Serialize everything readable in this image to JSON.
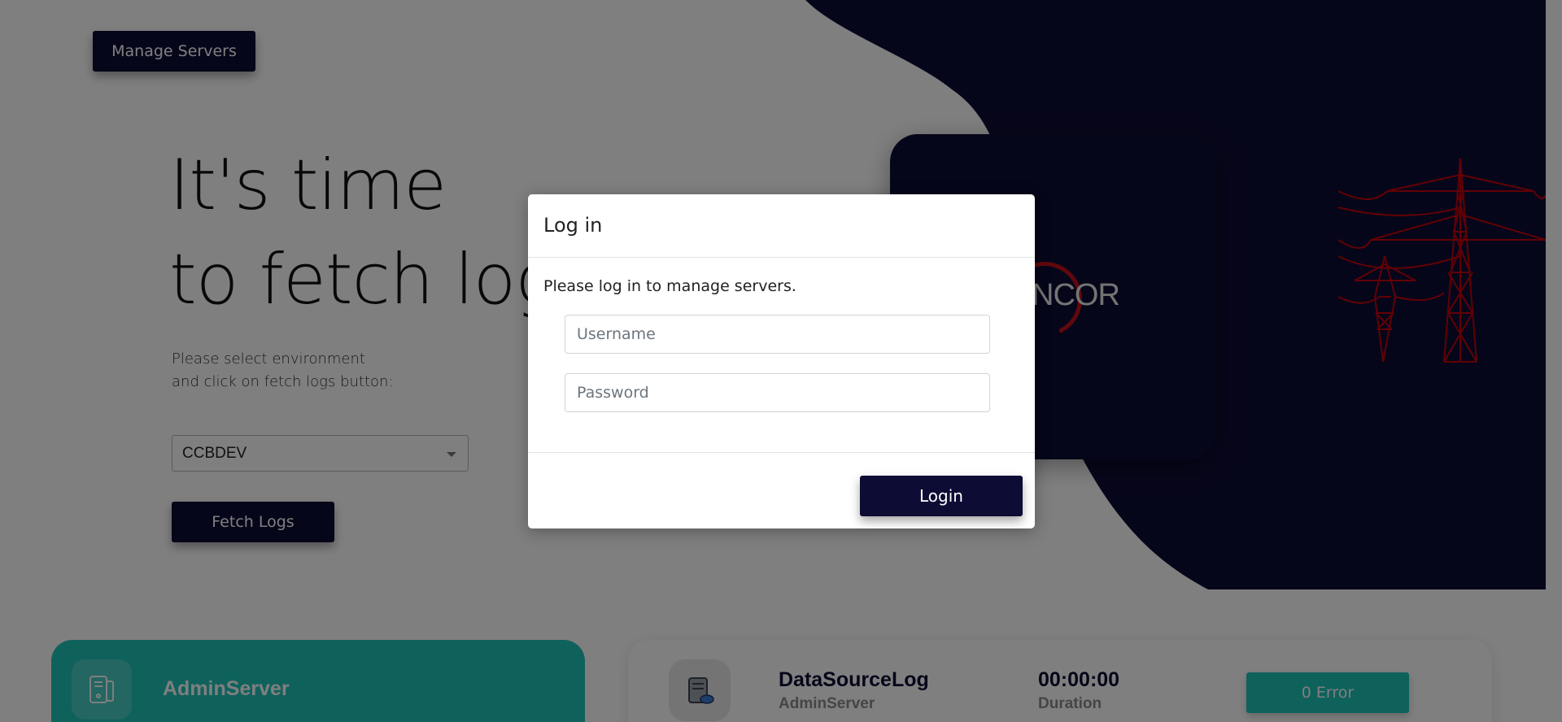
{
  "header": {
    "manage_servers_label": "Manage Servers"
  },
  "hero": {
    "title_line1": "It's time",
    "title_line2": "to fetch logs",
    "desc_line1": "Please select environment",
    "desc_line2": "and click on fetch logs button:"
  },
  "environment": {
    "selected": "CCBDEV"
  },
  "fetch_label": "Fetch Logs",
  "logo": {
    "text": "NCOR"
  },
  "admin_card": {
    "title": "AdminServer",
    "icon": "server-icon"
  },
  "log_card": {
    "name": "DataSourceLog",
    "server": "AdminServer",
    "duration": "00:00:00",
    "duration_label": "Duration",
    "error_label": "0 Error",
    "icon": "server-log-icon"
  },
  "modal": {
    "title": "Log in",
    "message": "Please log in to manage servers.",
    "username": {
      "placeholder": "Username",
      "value": ""
    },
    "password": {
      "placeholder": "Password",
      "value": ""
    },
    "login_label": "Login"
  },
  "colors": {
    "navy": "#0d0c35",
    "teal": "#1fc3b9",
    "logo_red": "#c0101a",
    "tower_red": "#c4000a"
  }
}
